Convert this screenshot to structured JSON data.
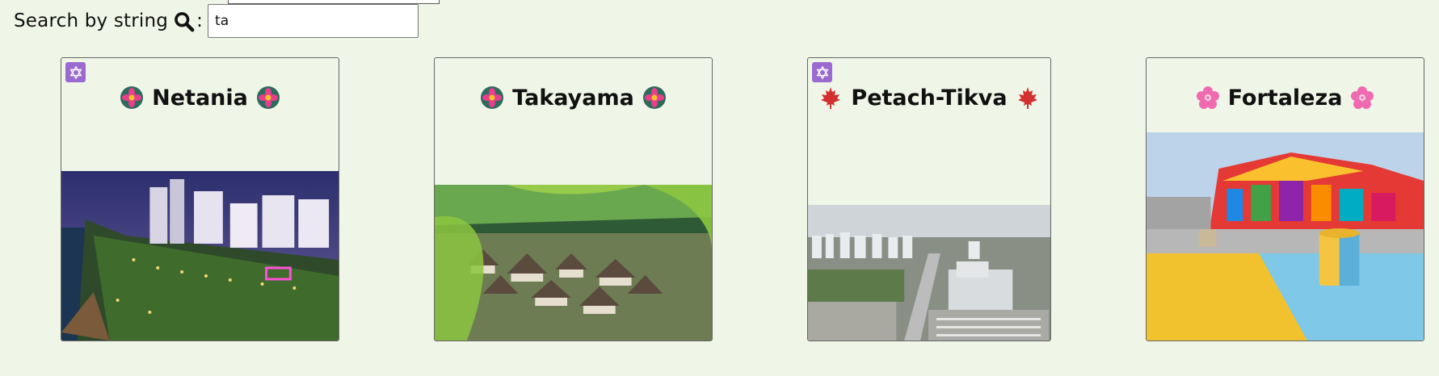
{
  "search": {
    "label": "Search by string",
    "colon": ":",
    "value": "ta"
  },
  "cards": [
    {
      "title": "Netania",
      "badge": "star-of-david",
      "emoji": "lotus"
    },
    {
      "title": "Takayama",
      "badge": null,
      "emoji": "lotus"
    },
    {
      "title": "Petach-Tikva",
      "badge": "star-of-david",
      "emoji": "maple-leaf"
    },
    {
      "title": "Fortaleza",
      "badge": null,
      "emoji": "cherry-blossom"
    }
  ],
  "colors": {
    "background": "#f0f6e7",
    "badge": "#9b6ad0",
    "lotus_petal": "#e83e8c",
    "maple": "#d32f2f",
    "blossom": "#f06ab0"
  }
}
